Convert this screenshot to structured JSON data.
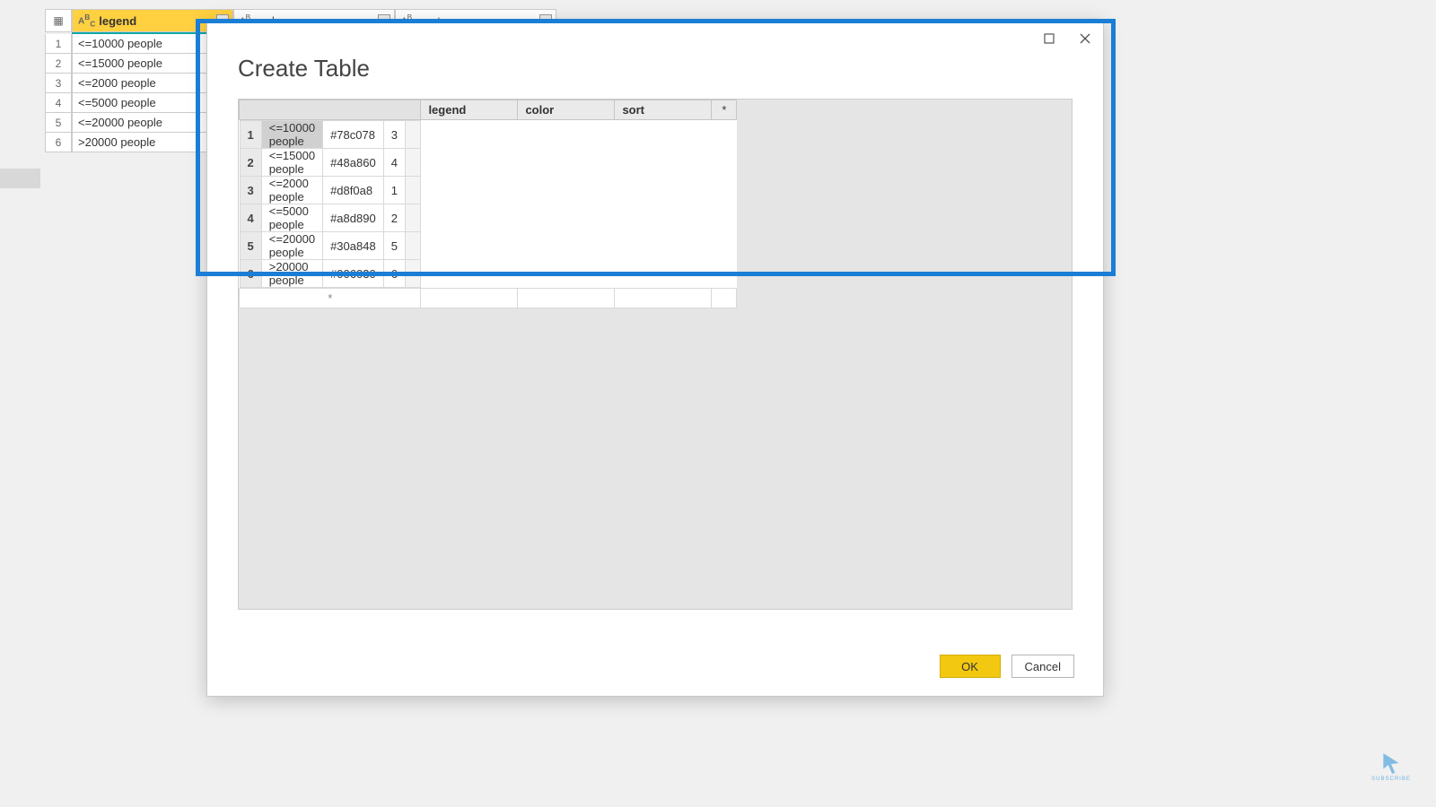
{
  "background_grid": {
    "columns": [
      {
        "name": "legend",
        "highlighted": true
      },
      {
        "name": "color",
        "highlighted": false
      },
      {
        "name": "sort",
        "highlighted": false
      }
    ],
    "rows": [
      {
        "n": "1",
        "legend": "<=10000 people"
      },
      {
        "n": "2",
        "legend": "<=15000 people"
      },
      {
        "n": "3",
        "legend": "<=2000 people"
      },
      {
        "n": "4",
        "legend": "<=5000 people"
      },
      {
        "n": "5",
        "legend": "<=20000 people"
      },
      {
        "n": "6",
        "legend": ">20000 people"
      }
    ]
  },
  "dialog": {
    "title": "Create Table",
    "columns": {
      "c1": "legend",
      "c2": "color",
      "c3": "sort",
      "star": "*"
    },
    "rows": [
      {
        "n": "1",
        "legend": "<=10000 people",
        "color": "#78c078",
        "sort": "3",
        "selected": true
      },
      {
        "n": "2",
        "legend": "<=15000 people",
        "color": "#48a860",
        "sort": "4",
        "selected": false
      },
      {
        "n": "3",
        "legend": "<=2000 people",
        "color": "#d8f0a8",
        "sort": "1",
        "selected": false
      },
      {
        "n": "4",
        "legend": "<=5000 people",
        "color": "#a8d890",
        "sort": "2",
        "selected": false
      },
      {
        "n": "5",
        "legend": "<=20000 people",
        "color": "#30a848",
        "sort": "5",
        "selected": false
      },
      {
        "n": "6",
        "legend": ">20000 people",
        "color": "#006030",
        "sort": "6",
        "selected": false
      }
    ],
    "new_row_marker": "*",
    "buttons": {
      "ok": "OK",
      "cancel": "Cancel"
    }
  },
  "watermark_text": "SUBSCRIBE"
}
